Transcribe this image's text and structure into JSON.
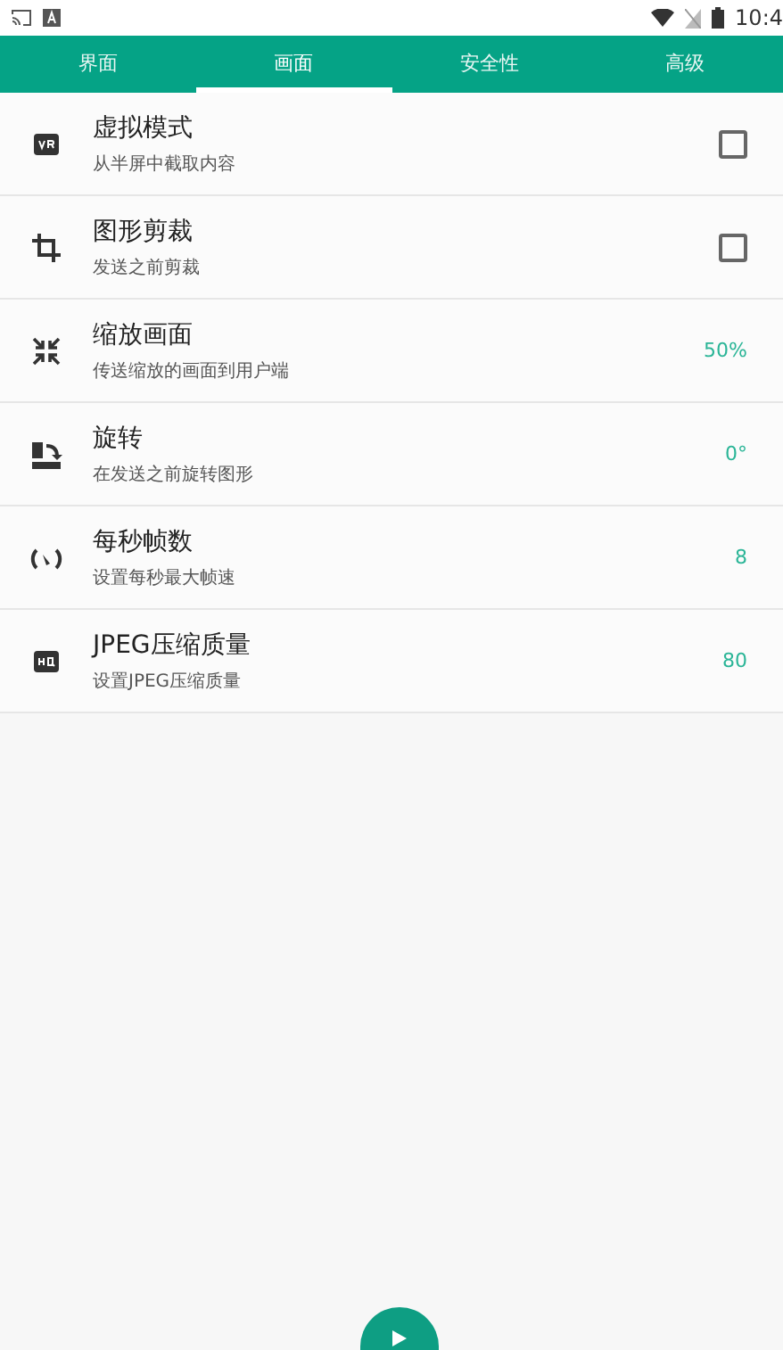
{
  "status_bar": {
    "time": "10:4"
  },
  "tabs": [
    {
      "label": "界面",
      "selected": false
    },
    {
      "label": "画面",
      "selected": true
    },
    {
      "label": "安全性",
      "selected": false
    },
    {
      "label": "高级",
      "selected": false
    }
  ],
  "settings": [
    {
      "kind": "checkbox",
      "title": "虚拟模式",
      "subtitle": "从半屏中截取内容",
      "checked": false
    },
    {
      "kind": "checkbox",
      "title": "图形剪裁",
      "subtitle": "发送之前剪裁",
      "checked": false
    },
    {
      "kind": "value",
      "title": "缩放画面",
      "subtitle": "传送缩放的画面到用户端",
      "value": "50%"
    },
    {
      "kind": "value",
      "title": "旋转",
      "subtitle": "在发送之前旋转图形",
      "value": "0°"
    },
    {
      "kind": "value",
      "title": "每秒帧数",
      "subtitle": "设置每秒最大帧速",
      "value": "8"
    },
    {
      "kind": "value",
      "title": "JPEG压缩质量",
      "subtitle": "设置JPEG压缩质量",
      "value": "80"
    }
  ]
}
